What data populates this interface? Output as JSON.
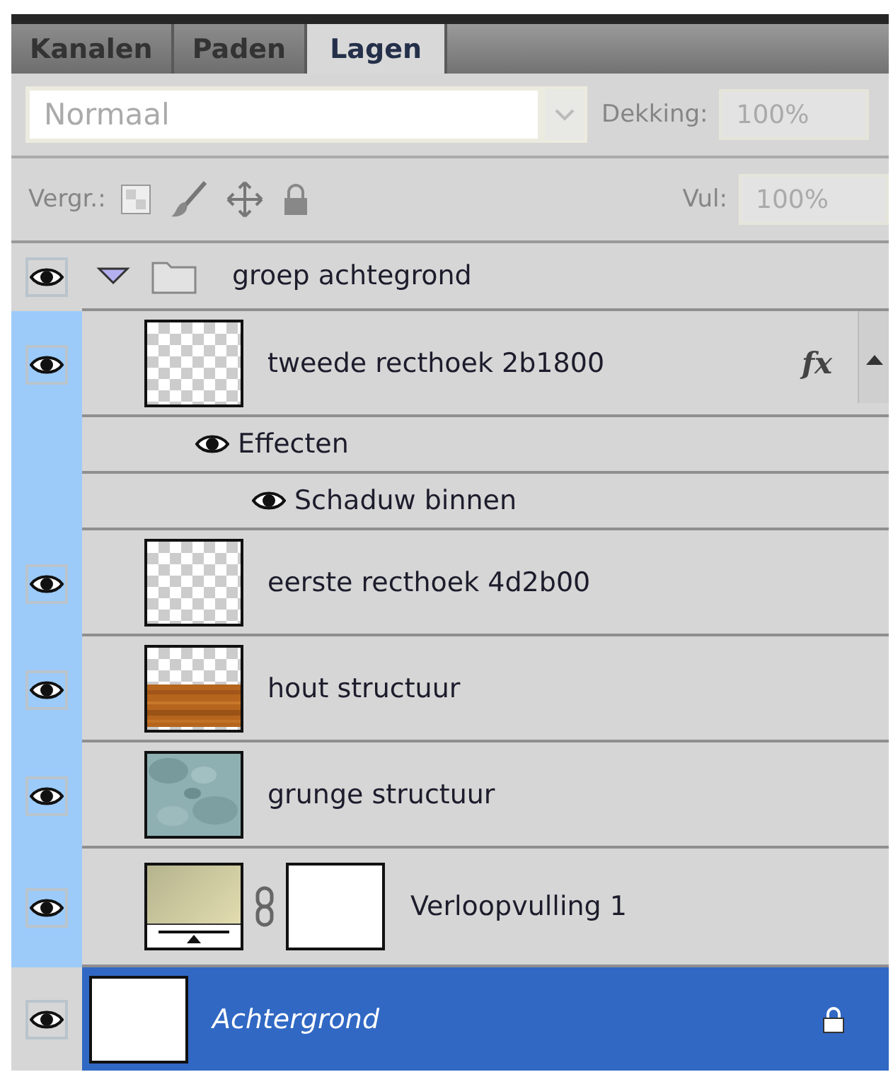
{
  "tabs": [
    {
      "label": "Kanalen",
      "selected": false
    },
    {
      "label": "Paden",
      "selected": false
    },
    {
      "label": "Lagen",
      "selected": true
    }
  ],
  "blend": {
    "mode": "Normaal",
    "opacity_label": "Dekking:",
    "opacity": "100%"
  },
  "lock": {
    "label": "Vergr.:",
    "fill_label": "Vul:",
    "fill": "100%"
  },
  "layers": [
    {
      "kind": "group",
      "name": "groep achtegrond",
      "visible": true,
      "expanded": true,
      "selected": false,
      "children": [
        {
          "kind": "layer",
          "name": "tweede recthoek 2b1800",
          "thumbnail": {
            "kind": "transparent"
          },
          "visible": true,
          "selected": false,
          "effects_badge": "fx",
          "effects": [
            {
              "name": "Effecten",
              "visible": true,
              "children": [
                {
                  "name": "Schaduw binnen",
                  "visible": true
                }
              ]
            }
          ]
        },
        {
          "kind": "layer",
          "name": "eerste recthoek 4d2b00",
          "thumbnail": {
            "kind": "transparent"
          },
          "visible": true,
          "selected": false
        },
        {
          "kind": "layer",
          "name": "hout structuur",
          "thumbnail": {
            "kind": "wood"
          },
          "visible": true,
          "selected": false
        },
        {
          "kind": "layer",
          "name": "grunge structuur",
          "thumbnail": {
            "kind": "grunge"
          },
          "visible": true,
          "selected": false
        },
        {
          "kind": "adjustment",
          "name": "Verloopvulling 1",
          "thumbnail": {
            "kind": "gradient"
          },
          "visible": true,
          "selected": false
        }
      ]
    },
    {
      "kind": "background",
      "name": "Achtergrond",
      "thumbnail": {
        "kind": "white"
      },
      "visible": true,
      "selected": true,
      "locked": true
    }
  ]
}
